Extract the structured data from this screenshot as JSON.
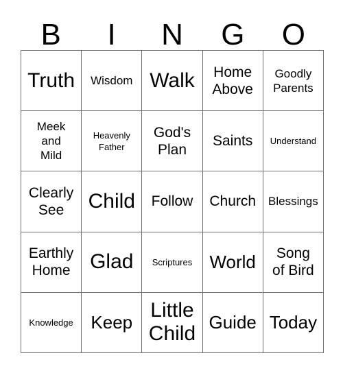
{
  "card": {
    "headers": [
      "B",
      "I",
      "N",
      "G",
      "O"
    ],
    "rows": [
      [
        {
          "text": "Truth",
          "size": "xl"
        },
        {
          "text": "Wisdom",
          "size": "sm"
        },
        {
          "text": "Walk",
          "size": "xl"
        },
        {
          "text": "Home\nAbove",
          "size": "md"
        },
        {
          "text": "Goodly\nParents",
          "size": "sm"
        }
      ],
      [
        {
          "text": "Meek\nand\nMild",
          "size": "sm"
        },
        {
          "text": "Heavenly\nFather",
          "size": "xs"
        },
        {
          "text": "God's\nPlan",
          "size": "md"
        },
        {
          "text": "Saints",
          "size": "md"
        },
        {
          "text": "Understand",
          "size": "xs"
        }
      ],
      [
        {
          "text": "Clearly\nSee",
          "size": "md"
        },
        {
          "text": "Child",
          "size": "xl"
        },
        {
          "text": "Follow",
          "size": "md"
        },
        {
          "text": "Church",
          "size": "md"
        },
        {
          "text": "Blessings",
          "size": "sm"
        }
      ],
      [
        {
          "text": "Earthly\nHome",
          "size": "md"
        },
        {
          "text": "Glad",
          "size": "xl"
        },
        {
          "text": "Scriptures",
          "size": "xs"
        },
        {
          "text": "World",
          "size": "lg"
        },
        {
          "text": "Song\nof Bird",
          "size": "md"
        }
      ],
      [
        {
          "text": "Knowledge",
          "size": "xs"
        },
        {
          "text": "Keep",
          "size": "lg"
        },
        {
          "text": "Little\nChild",
          "size": "xl"
        },
        {
          "text": "Guide",
          "size": "lg"
        },
        {
          "text": "Today",
          "size": "lg"
        }
      ]
    ]
  },
  "colors": {
    "text": "#000000",
    "border": "#6e6e6e",
    "background": "#ffffff"
  }
}
